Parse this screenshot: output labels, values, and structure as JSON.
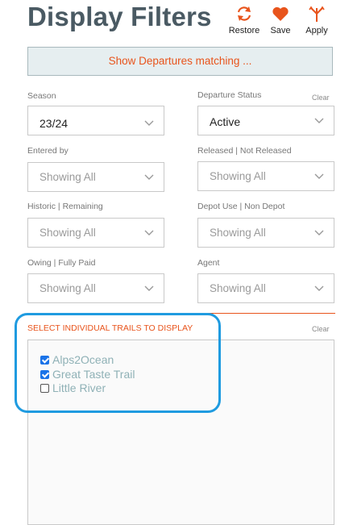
{
  "header": {
    "title": "Display Filters",
    "restore_label": "Restore",
    "save_label": "Save",
    "apply_label": "Apply",
    "accent_color": "#e8541c"
  },
  "banner": {
    "text": "Show Departures matching ..."
  },
  "filters": {
    "season": {
      "label": "Season",
      "value": "23/24"
    },
    "departure_status": {
      "label": "Departure Status",
      "value": "Active",
      "clear": "Clear"
    },
    "entered_by": {
      "label": "Entered by",
      "value": "Showing All"
    },
    "released": {
      "label": "Released | Not Released",
      "value": "Showing All"
    },
    "historic": {
      "label": "Historic | Remaining",
      "value": "Showing All"
    },
    "depot": {
      "label": "Depot Use | Non Depot",
      "value": "Showing All"
    },
    "owing": {
      "label": "Owing | Fully Paid",
      "value": "Showing All"
    },
    "agent": {
      "label": "Agent",
      "value": "Showing All"
    }
  },
  "trails": {
    "label": "SELECT INDIVIDUAL TRAILS TO DISPLAY",
    "clear": "Clear",
    "items": [
      {
        "name": "Alps2Ocean",
        "checked": true
      },
      {
        "name": "Great Taste Trail",
        "checked": true
      },
      {
        "name": "Little River",
        "checked": false
      }
    ]
  },
  "icons": [
    "refresh-icon",
    "heart-icon",
    "apply-icon",
    "chevron-down-icon"
  ]
}
